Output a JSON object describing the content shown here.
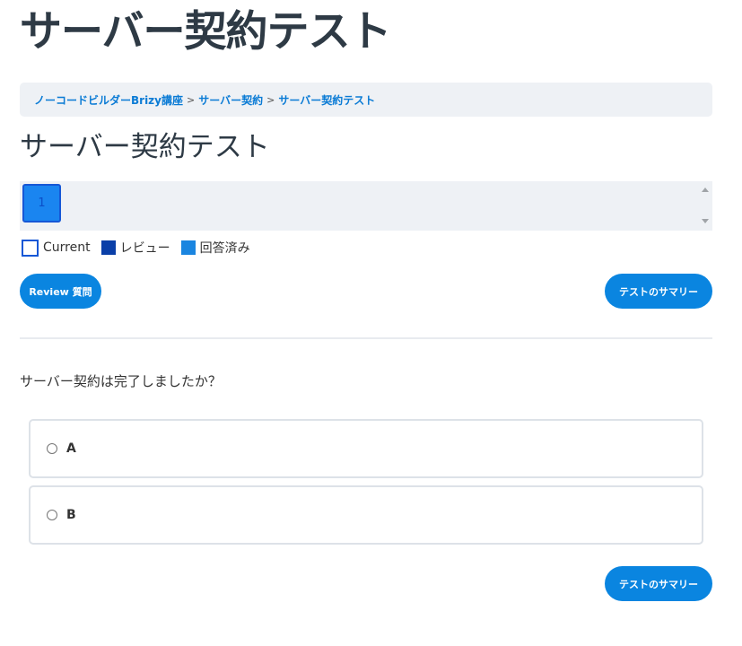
{
  "page": {
    "title": "サーバー契約テスト"
  },
  "breadcrumb": {
    "items": [
      "ノーコードビルダーBrizy講座",
      "サーバー契約",
      "サーバー契約テスト"
    ],
    "separator": ">"
  },
  "quiz": {
    "title": "サーバー契約テスト",
    "question_numbers": [
      "1"
    ],
    "legend": {
      "current": "Current",
      "review": "レビュー",
      "answered": "回答済み"
    },
    "review_button": "Review 質問",
    "summary_button": "テストのサマリー",
    "question": "サーバー契約は完了しましたか？",
    "options": [
      "A",
      "B"
    ]
  },
  "colors": {
    "accent": "#0a85e0",
    "current_border": "#1557d6",
    "review": "#0a3fa8",
    "answered": "#1a85e0"
  }
}
